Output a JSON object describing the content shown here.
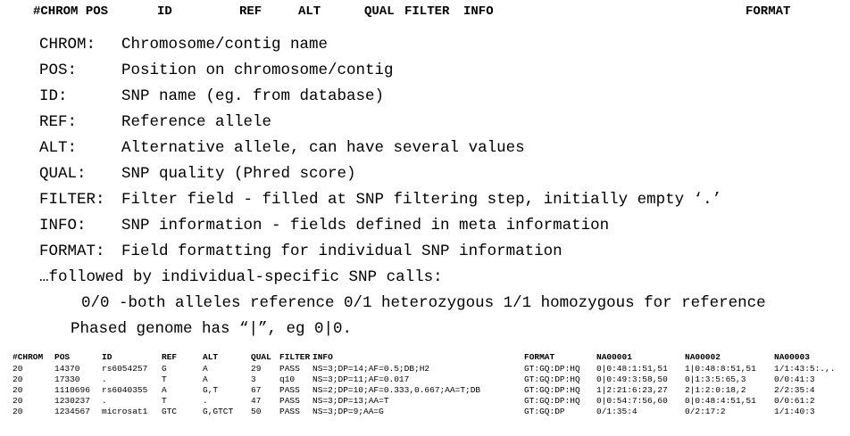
{
  "top_header": [
    "#CHROM",
    "POS",
    "ID",
    "REF",
    "ALT",
    "QUAL",
    "FILTER",
    "INFO",
    "FORMAT"
  ],
  "definitions": [
    {
      "key": "CHROM:",
      "value": "Chromosome/contig name"
    },
    {
      "key": "POS:",
      "value": "Position on chromosome/contig"
    },
    {
      "key": "ID:",
      "value": "SNP name (eg. from database)"
    },
    {
      "key": "REF:",
      "value": "Reference allele"
    },
    {
      "key": "ALT:",
      "value": "Alternative allele, can have several values"
    },
    {
      "key": "QUAL:",
      "value": "SNP quality (Phred score)"
    },
    {
      "key": "FILTER:",
      "value": "Filter field - filled at SNP filtering step, initially empty ‘.’"
    },
    {
      "key": "INFO:",
      "value": "SNP information - fields defined in meta information"
    },
    {
      "key": "FORMAT:",
      "value": "Field formatting for individual SNP information"
    }
  ],
  "followed_text": "…followed by individual-specific SNP calls:",
  "calls_text": "0/0 -both alleles reference 0/1 heterozygous 1/1 homozygous for reference",
  "phased_text": "Phased genome has “|”, eg 0|0.",
  "table": {
    "header": [
      "#CHROM",
      "POS",
      "ID",
      "REF",
      "ALT",
      "QUAL",
      "FILTER",
      "INFO",
      "FORMAT",
      "NA00001",
      "NA00002",
      "NA00003"
    ],
    "rows": [
      [
        "20",
        "14370",
        "rs6054257",
        "G",
        "A",
        "29",
        "PASS",
        "NS=3;DP=14;AF=0.5;DB;H2",
        "GT:GQ:DP:HQ",
        "0|0:48:1:51,51",
        "1|0:48:8:51,51",
        "1/1:43:5:.,."
      ],
      [
        "20",
        "17330",
        ".",
        "T",
        "A",
        "3",
        "q10",
        "NS=3;DP=11;AF=0.017",
        "GT:GQ:DP:HQ",
        "0|0:49:3:58,50",
        "0|1:3:5:65,3",
        "0/0:41:3"
      ],
      [
        "20",
        "1110696",
        "rs6040355",
        "A",
        "G,T",
        "67",
        "PASS",
        "NS=2;DP=10;AF=0.333,0.667;AA=T;DB",
        "GT:GQ:DP:HQ",
        "1|2:21:6:23,27",
        "2|1:2:0:18,2",
        "2/2:35:4"
      ],
      [
        "20",
        "1230237",
        ".",
        "T",
        ".",
        "47",
        "PASS",
        "NS=3;DP=13;AA=T",
        "GT:GQ:DP:HQ",
        "0|0:54:7:56,60",
        "0|0:48:4:51,51",
        "0/0:61:2"
      ],
      [
        "20",
        "1234567",
        "microsat1",
        "GTC",
        "G,GTCT",
        "50",
        "PASS",
        "NS=3;DP=9;AA=G",
        "GT:GQ:DP",
        "0/1:35:4",
        "0/2:17:2",
        "1/1:40:3"
      ]
    ]
  }
}
